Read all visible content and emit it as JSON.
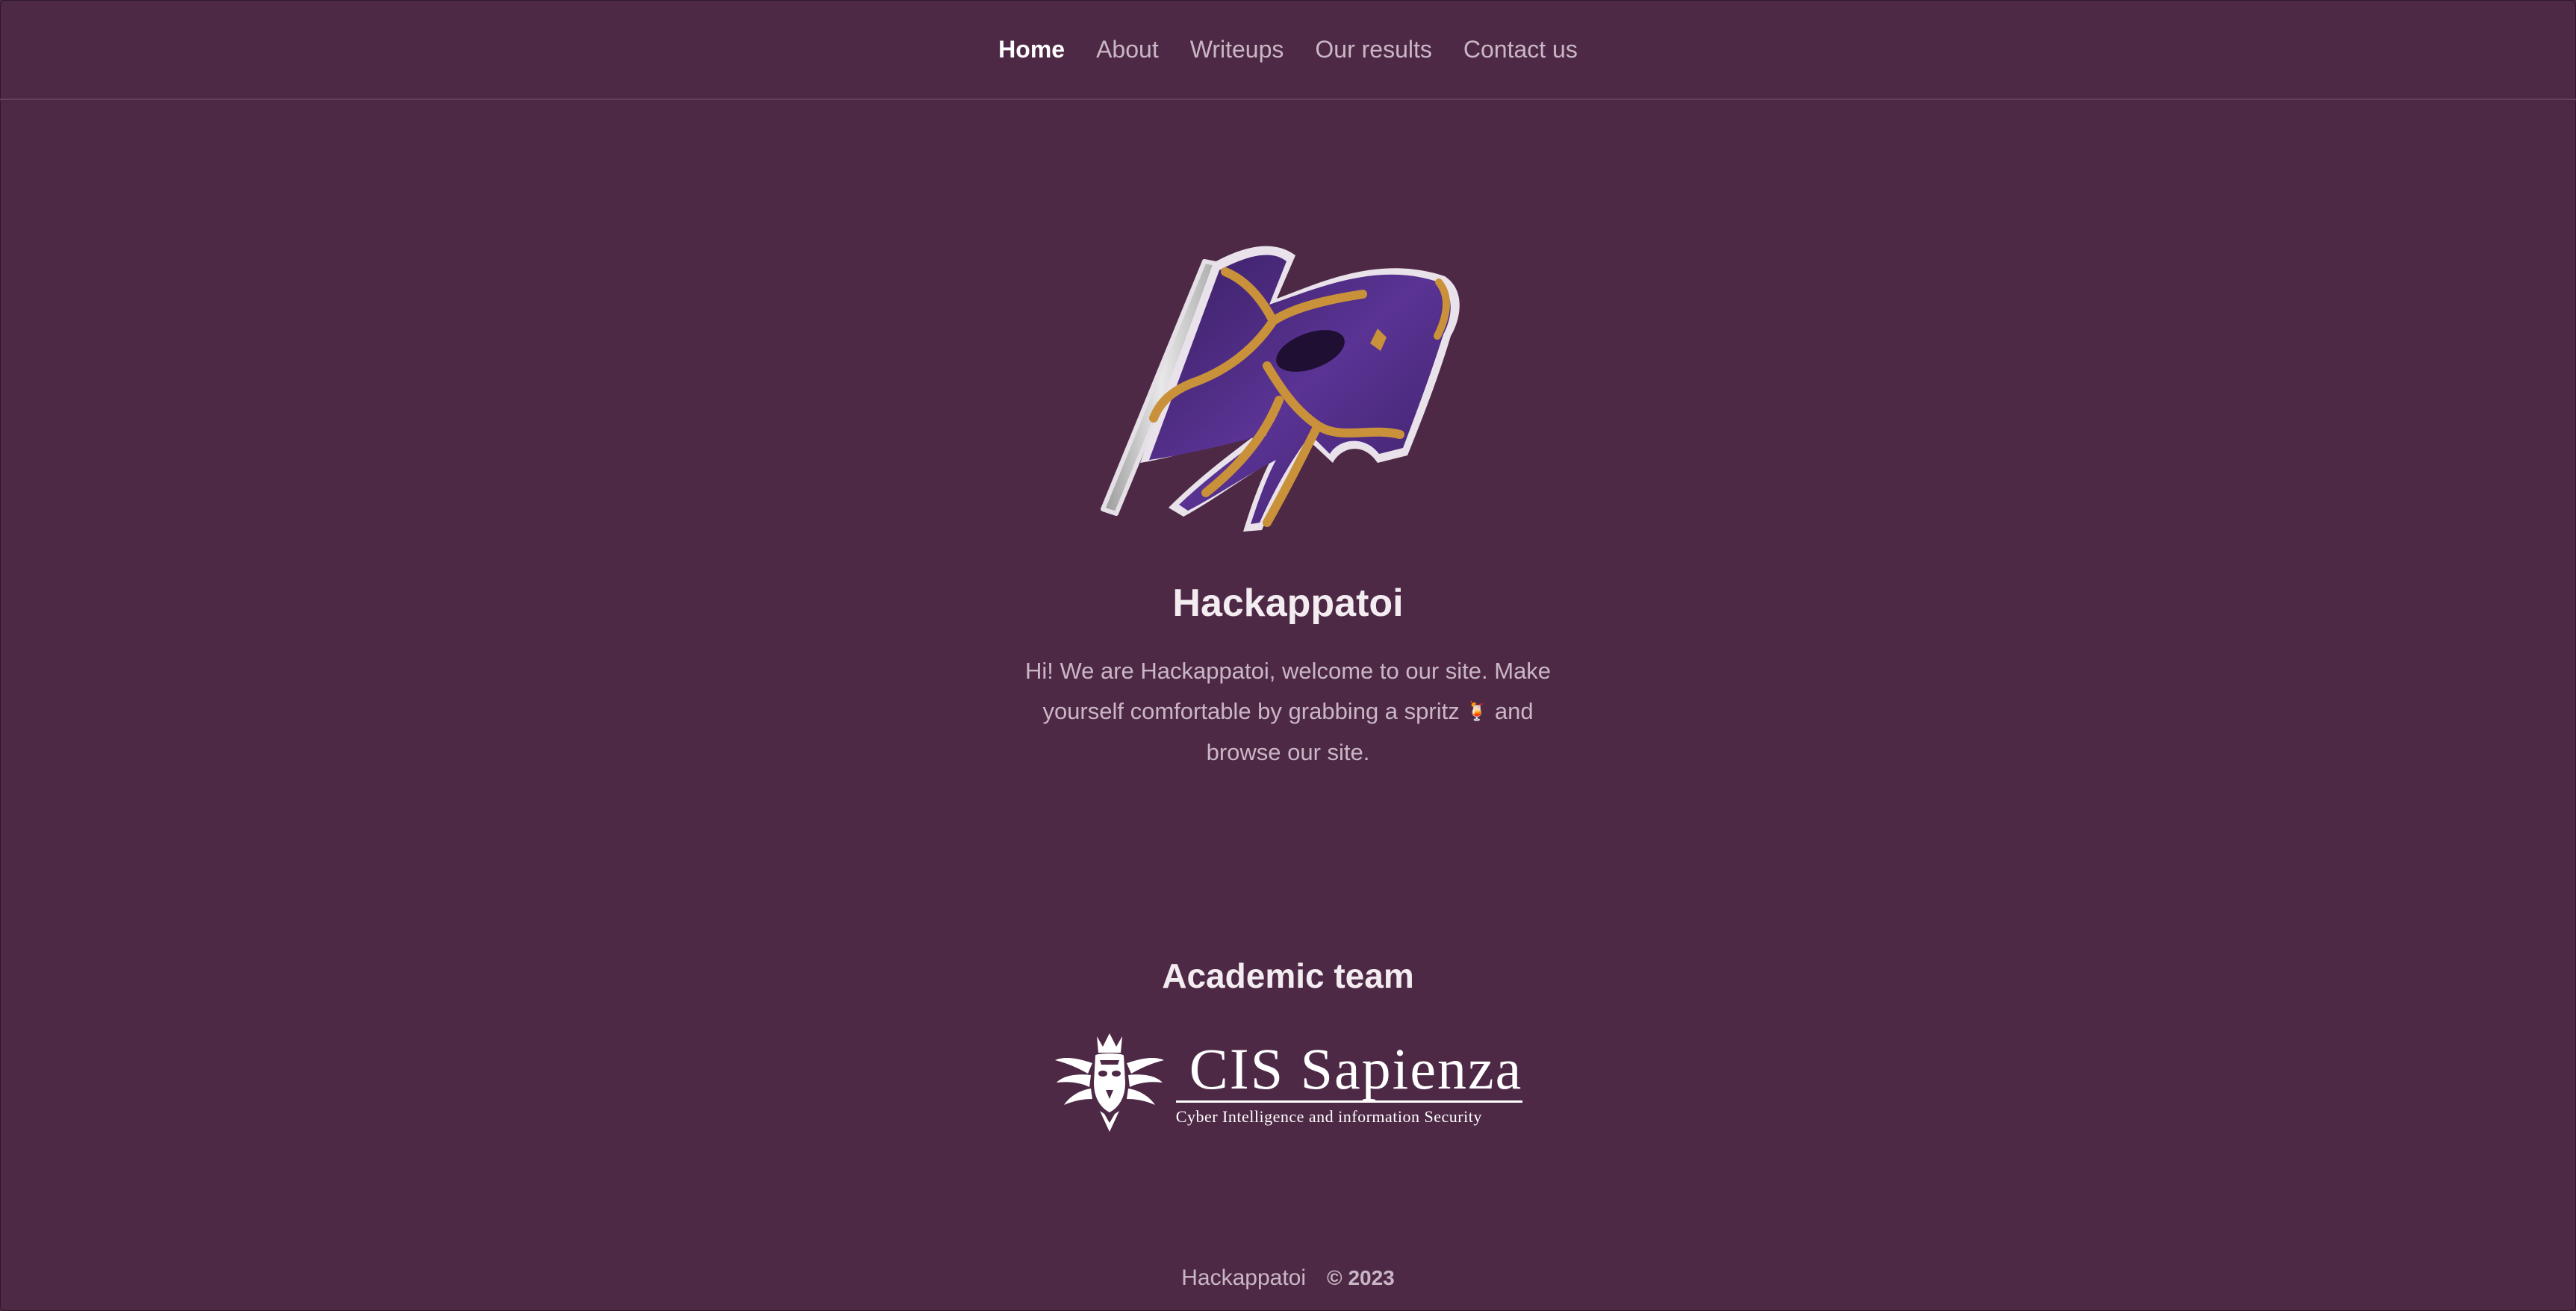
{
  "nav": {
    "items": [
      {
        "label": "Home",
        "active": true
      },
      {
        "label": "About",
        "active": false
      },
      {
        "label": "Writeups",
        "active": false
      },
      {
        "label": "Our results",
        "active": false
      },
      {
        "label": "Contact us",
        "active": false
      }
    ]
  },
  "hero": {
    "logo_icon": "flag-logo-icon",
    "title": "Hackappatoi",
    "text_before": "Hi! We are Hackappatoi, welcome to our site. Make yourself comfortable by grabbing a spritz ",
    "spritz_icon": "🍹",
    "text_after": " and browse our site."
  },
  "academic": {
    "title": "Academic team",
    "logo_name": "CIS Sapienza",
    "logo_subtitle": "Cyber Intelligence and information Security"
  },
  "footer": {
    "brand": "Hackappatoi",
    "copyright": "© 2023"
  },
  "colors": {
    "background": "#4e2946",
    "text_muted": "#c9b7c5",
    "flag_purple": "#4a2a78",
    "flag_gold": "#c9913a"
  }
}
